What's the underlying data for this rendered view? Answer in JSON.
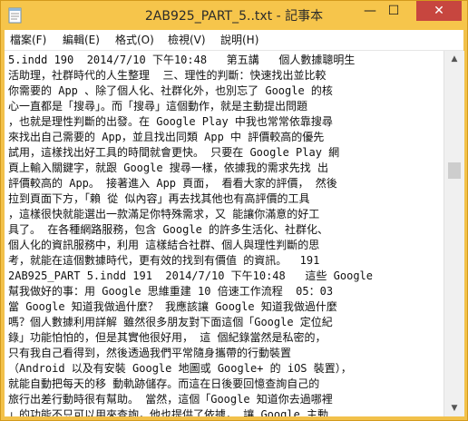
{
  "window": {
    "title": "2AB925_PART_5..txt - 記事本",
    "minimize_symbol": "—",
    "maximize_symbol": "☐",
    "close_symbol": "✕"
  },
  "menu": [
    "檔案(F)",
    "編輯(E)",
    "格式(O)",
    "檢視(V)",
    "說明(H)"
  ],
  "document": {
    "lines": [
      "5.indd 190  2014/7/10 下午10:48   第五講   個人數據聰明生",
      "活助理，社群時代的人生整理  三、理性的判斷：快速找出並比較",
      "你需要的 App 、除了個人化、社群化外，也別忘了 Google 的核",
      "心一直都是「搜尋」。而「搜尋」這個動作，就是主動提出問題",
      "，也就是理性判斷的出發。在 Google Play 中我也常常依靠搜尋",
      "來找出自己需要的 App，並且找出同類 App 中 評價較高的優先",
      "試用，這樣找出好工具的時間就會更快。 只要在 Google Play 網",
      "頁上輸入關鍵字，就跟 Google 搜尋一樣，依據我的需求先找 出",
      "評價較高的 App。 接著進入 App 頁面， 看看大家的評價， 然後",
      "拉到頁面下方，「賴 從 似內容」再去找其他也有高評價的工具",
      "，這樣很快就能選出一款滿足你特殊需求，又 能讓你滿意的好工",
      "具了。 在各種網路服務，包含 Google 的許多生活化、社群化、",
      "個人化的資訊服務中，利用 這樣結合社群、個人與理性判斷的思",
      "考，就能在這個數據時代，更有效的找到有價值 的資訊。  191",
      "2AB925_PART 5.indd 191  2014/7/10 下午10:48   這些 Google",
      "幫我做好的事：用 Google 思維重建 10 倍速工作流程  05：03",
      "當 Google 知道我做過什麼？ 我應該讓 Google 知道我做過什麼",
      "嗎？個人數據利用詳解 雖然很多朋友對下面這個「Google 定位紀",
      "錄」功能怕怕的，但是其實他很好用， 這 個紀錄當然是私密的，",
      "只有我自己看得到，然後透過我們平常隨身攜帶的行動裝置",
      "（Android 以及有安裝 Google 地圖或 Google+ 的 iOS 裝置），",
      "就能自動把每天的移 動軌跡儲存。而這在日後要回憶查詢自己的",
      "旅行出差行動時很有幫助。 當然，這個「Google 知道你去過哪裡",
      "」的功能不只可以用來查詢，他也提供了依據， 讓 Google 主動"
    ]
  },
  "scrollbar": {
    "up_symbol": "▲",
    "down_symbol": "▼",
    "position_fraction": 0.3
  },
  "colors": {
    "frame": "#f2c14a",
    "close_button": "#c7463f",
    "text": "#111111"
  }
}
